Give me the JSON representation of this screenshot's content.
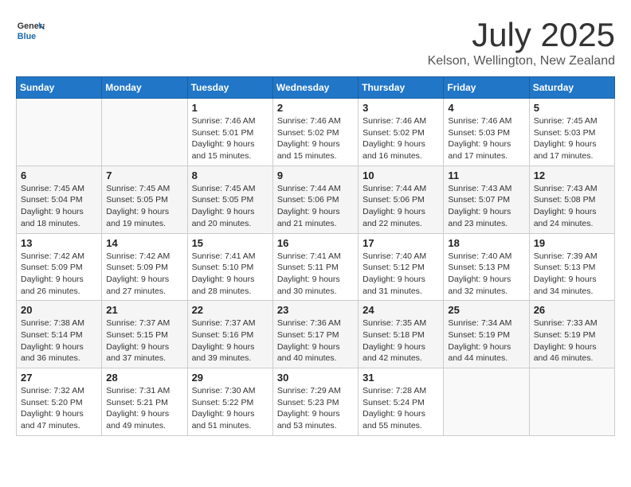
{
  "header": {
    "logo_general": "General",
    "logo_blue": "Blue",
    "month_title": "July 2025",
    "location": "Kelson, Wellington, New Zealand"
  },
  "days_of_week": [
    "Sunday",
    "Monday",
    "Tuesday",
    "Wednesday",
    "Thursday",
    "Friday",
    "Saturday"
  ],
  "weeks": [
    [
      {
        "day": "",
        "empty": true
      },
      {
        "day": "",
        "empty": true
      },
      {
        "day": "1",
        "sunrise": "7:46 AM",
        "sunset": "5:01 PM",
        "daylight": "9 hours and 15 minutes."
      },
      {
        "day": "2",
        "sunrise": "7:46 AM",
        "sunset": "5:02 PM",
        "daylight": "9 hours and 15 minutes."
      },
      {
        "day": "3",
        "sunrise": "7:46 AM",
        "sunset": "5:02 PM",
        "daylight": "9 hours and 16 minutes."
      },
      {
        "day": "4",
        "sunrise": "7:46 AM",
        "sunset": "5:03 PM",
        "daylight": "9 hours and 17 minutes."
      },
      {
        "day": "5",
        "sunrise": "7:45 AM",
        "sunset": "5:03 PM",
        "daylight": "9 hours and 17 minutes."
      }
    ],
    [
      {
        "day": "6",
        "sunrise": "7:45 AM",
        "sunset": "5:04 PM",
        "daylight": "9 hours and 18 minutes."
      },
      {
        "day": "7",
        "sunrise": "7:45 AM",
        "sunset": "5:05 PM",
        "daylight": "9 hours and 19 minutes."
      },
      {
        "day": "8",
        "sunrise": "7:45 AM",
        "sunset": "5:05 PM",
        "daylight": "9 hours and 20 minutes."
      },
      {
        "day": "9",
        "sunrise": "7:44 AM",
        "sunset": "5:06 PM",
        "daylight": "9 hours and 21 minutes."
      },
      {
        "day": "10",
        "sunrise": "7:44 AM",
        "sunset": "5:06 PM",
        "daylight": "9 hours and 22 minutes."
      },
      {
        "day": "11",
        "sunrise": "7:43 AM",
        "sunset": "5:07 PM",
        "daylight": "9 hours and 23 minutes."
      },
      {
        "day": "12",
        "sunrise": "7:43 AM",
        "sunset": "5:08 PM",
        "daylight": "9 hours and 24 minutes."
      }
    ],
    [
      {
        "day": "13",
        "sunrise": "7:42 AM",
        "sunset": "5:09 PM",
        "daylight": "9 hours and 26 minutes."
      },
      {
        "day": "14",
        "sunrise": "7:42 AM",
        "sunset": "5:09 PM",
        "daylight": "9 hours and 27 minutes."
      },
      {
        "day": "15",
        "sunrise": "7:41 AM",
        "sunset": "5:10 PM",
        "daylight": "9 hours and 28 minutes."
      },
      {
        "day": "16",
        "sunrise": "7:41 AM",
        "sunset": "5:11 PM",
        "daylight": "9 hours and 30 minutes."
      },
      {
        "day": "17",
        "sunrise": "7:40 AM",
        "sunset": "5:12 PM",
        "daylight": "9 hours and 31 minutes."
      },
      {
        "day": "18",
        "sunrise": "7:40 AM",
        "sunset": "5:13 PM",
        "daylight": "9 hours and 32 minutes."
      },
      {
        "day": "19",
        "sunrise": "7:39 AM",
        "sunset": "5:13 PM",
        "daylight": "9 hours and 34 minutes."
      }
    ],
    [
      {
        "day": "20",
        "sunrise": "7:38 AM",
        "sunset": "5:14 PM",
        "daylight": "9 hours and 36 minutes."
      },
      {
        "day": "21",
        "sunrise": "7:37 AM",
        "sunset": "5:15 PM",
        "daylight": "9 hours and 37 minutes."
      },
      {
        "day": "22",
        "sunrise": "7:37 AM",
        "sunset": "5:16 PM",
        "daylight": "9 hours and 39 minutes."
      },
      {
        "day": "23",
        "sunrise": "7:36 AM",
        "sunset": "5:17 PM",
        "daylight": "9 hours and 40 minutes."
      },
      {
        "day": "24",
        "sunrise": "7:35 AM",
        "sunset": "5:18 PM",
        "daylight": "9 hours and 42 minutes."
      },
      {
        "day": "25",
        "sunrise": "7:34 AM",
        "sunset": "5:19 PM",
        "daylight": "9 hours and 44 minutes."
      },
      {
        "day": "26",
        "sunrise": "7:33 AM",
        "sunset": "5:19 PM",
        "daylight": "9 hours and 46 minutes."
      }
    ],
    [
      {
        "day": "27",
        "sunrise": "7:32 AM",
        "sunset": "5:20 PM",
        "daylight": "9 hours and 47 minutes."
      },
      {
        "day": "28",
        "sunrise": "7:31 AM",
        "sunset": "5:21 PM",
        "daylight": "9 hours and 49 minutes."
      },
      {
        "day": "29",
        "sunrise": "7:30 AM",
        "sunset": "5:22 PM",
        "daylight": "9 hours and 51 minutes."
      },
      {
        "day": "30",
        "sunrise": "7:29 AM",
        "sunset": "5:23 PM",
        "daylight": "9 hours and 53 minutes."
      },
      {
        "day": "31",
        "sunrise": "7:28 AM",
        "sunset": "5:24 PM",
        "daylight": "9 hours and 55 minutes."
      },
      {
        "day": "",
        "empty": true
      },
      {
        "day": "",
        "empty": true
      }
    ]
  ],
  "labels": {
    "sunrise_label": "Sunrise:",
    "sunset_label": "Sunset:",
    "daylight_label": "Daylight:"
  }
}
